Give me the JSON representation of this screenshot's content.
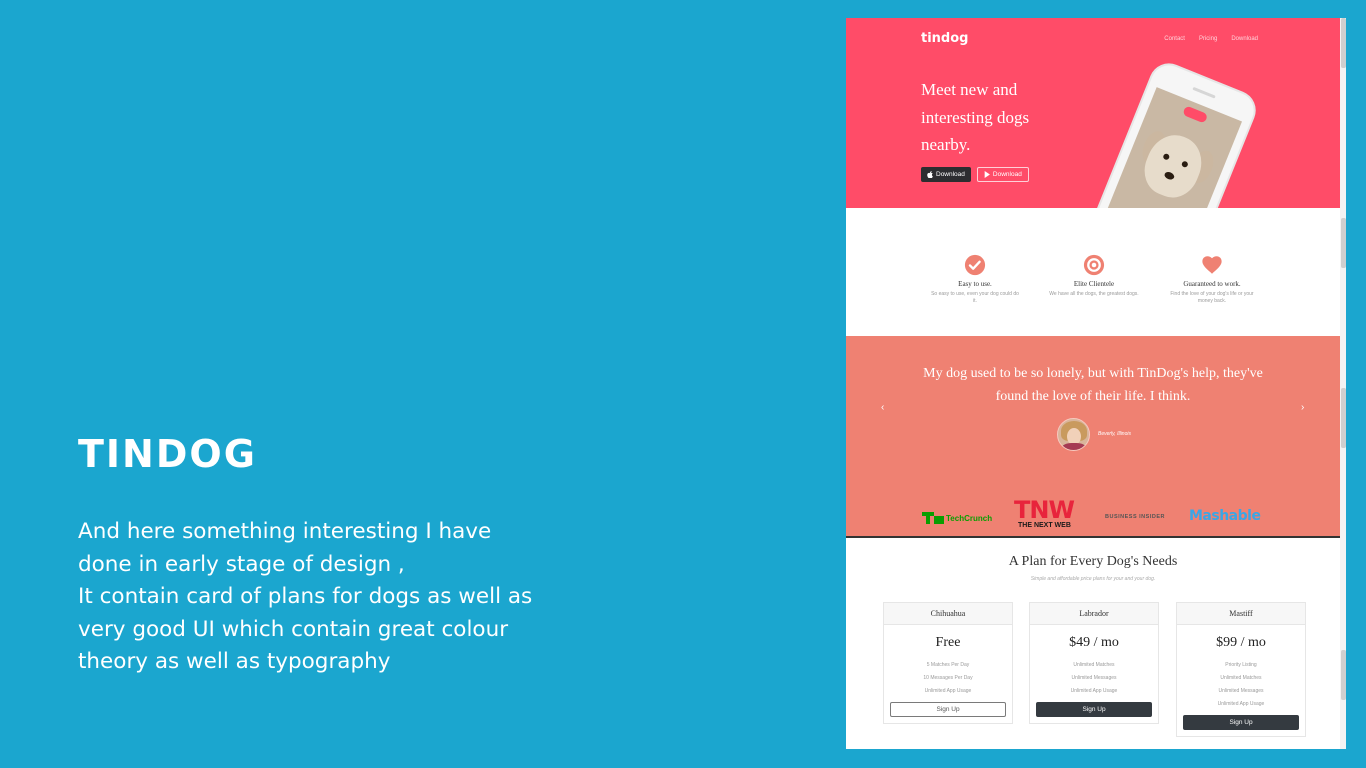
{
  "left": {
    "title": "TINDOG",
    "description_lines": [
      "And here something interesting I have",
      "done in early stage of design ,",
      "It contain card of plans for dogs as well as",
      "very good UI which contain great colour",
      "theory as well as typography"
    ]
  },
  "mock": {
    "brand": "tindog",
    "nav": [
      "Contact",
      "Pricing",
      "Download"
    ],
    "hero": {
      "title": "Meet new and interesting dogs nearby.",
      "buttons": [
        {
          "label": "Download",
          "icon": "apple-icon"
        },
        {
          "label": "Download",
          "icon": "play-icon"
        }
      ]
    },
    "features": [
      {
        "icon": "check-circle-icon",
        "title": "Easy to use.",
        "text": "So easy to use, even your dog could do it."
      },
      {
        "icon": "target-icon",
        "title": "Elite Clientele",
        "text": "We have all the dogs, the greatest dogs."
      },
      {
        "icon": "heart-icon",
        "title": "Guaranteed to work.",
        "text": "Find the love of your dog's life or your money back."
      }
    ],
    "testimonial": {
      "quote": "My dog used to be so lonely, but with TinDog's help, they've found the love of their life. I think.",
      "author": "Beverly, Illinois",
      "prev": "‹",
      "next": "›"
    },
    "press": {
      "techcrunch": "TechCrunch",
      "tnw_main": "TNW",
      "tnw_sub": "THE NEXT WEB",
      "business_insider": "BUSINESS INSIDER",
      "mashable": "Mashable"
    },
    "pricing": {
      "title": "A Plan for Every Dog's Needs",
      "subtitle": "Simple and affordable price plans for your and your dog.",
      "plans": [
        {
          "name": "Chihuahua",
          "price": "Free",
          "features": [
            "5 Matches Per Day",
            "10 Messages Per Day",
            "Unlimited App Usage"
          ],
          "button": "Sign Up",
          "style": "outline"
        },
        {
          "name": "Labrador",
          "price": "$49 / mo",
          "features": [
            "Unlimited Matches",
            "Unlimited Messages",
            "Unlimited App Usage"
          ],
          "button": "Sign Up",
          "style": "solid"
        },
        {
          "name": "Mastiff",
          "price": "$99 / mo",
          "features": [
            "Priority Listing",
            "Unlimited Matches",
            "Unlimited Messages",
            "Unlimited App Usage"
          ],
          "button": "Sign Up",
          "style": "solid"
        }
      ]
    }
  },
  "colors": {
    "background": "#1ba6cf",
    "hero": "#ff4c68",
    "testimonial": "#ef8172",
    "icon": "#ef8172"
  }
}
